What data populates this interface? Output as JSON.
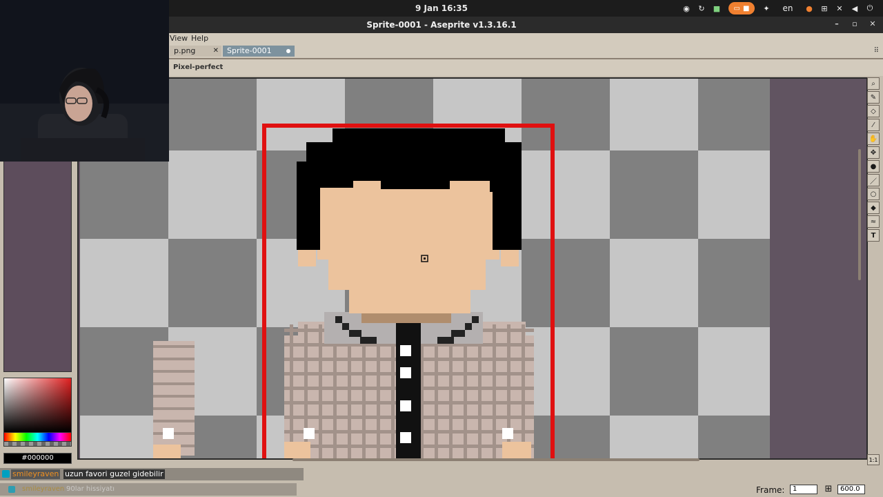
{
  "system": {
    "clock": "9 Jan  16:35",
    "language": "en",
    "tray_icons": [
      "chrome-icon",
      "sync-icon",
      "lock-icon",
      "screen-share-icon",
      "accessibility-icon",
      "language-indicator",
      "microphone-icon",
      "network-icon",
      "wifi-off-icon",
      "volume-icon",
      "power-icon"
    ]
  },
  "window": {
    "title": "Sprite-0001 - Aseprite v1.3.16.1"
  },
  "menubar": {
    "items": [
      "View",
      "Help"
    ]
  },
  "tabs": [
    {
      "label": "p.png",
      "active": false
    },
    {
      "label": "Sprite-0001",
      "active": true,
      "modified": true
    }
  ],
  "context_bar": {
    "pixel_perfect_label": "Pixel-perfect"
  },
  "tools": [
    "zoom-tool",
    "pencil-tool",
    "eraser-tool",
    "eyedropper-tool",
    "hand-tool",
    "move-tool",
    "fill-tool",
    "line-tool",
    "ellipse-tool",
    "blur-tool",
    "smudge-tool",
    "text-tool"
  ],
  "color": {
    "hex": "#000000",
    "picker_hue": "#e02020"
  },
  "canvas": {
    "checker_light": "#c6c6c6",
    "checker_dark": "#808080",
    "background": "#615461",
    "selection_color": "#e01010",
    "skin": "#ecc39d",
    "hair": "#000000",
    "shirt": "#c9b6ae",
    "shirt_grid": "#a2928a"
  },
  "status": {
    "frame_label": "Frame:",
    "frame_value": "1",
    "zoom_value": "600.0"
  },
  "chat": [
    {
      "user": "smileyraven",
      "message": "uzun favori guzel gidebilir"
    },
    {
      "user": "smileyraven",
      "message": "90lar hissiyatı"
    }
  ],
  "zoom_buttons": {
    "one_to_one": "1:1"
  }
}
